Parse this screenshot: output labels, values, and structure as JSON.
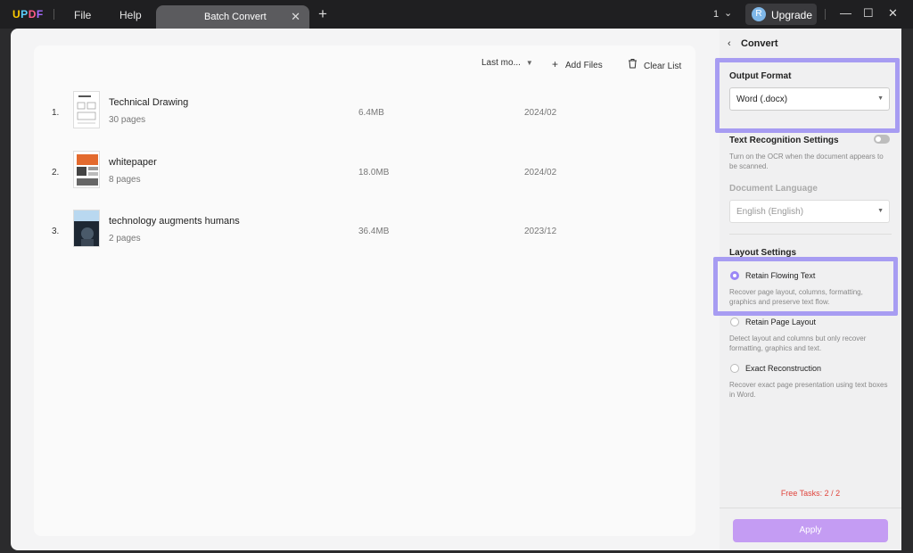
{
  "titlebar": {
    "logo": "UPDF",
    "menu_file": "File",
    "menu_help": "Help",
    "tab_label": "Batch Convert",
    "tab_close_icon": "close-icon",
    "tab_add_icon": "plus-icon",
    "page_indicator": "1",
    "upgrade_avatar": "R",
    "upgrade_label": "Upgrade"
  },
  "toolbar": {
    "sort_label": "Last mo...",
    "add_files_label": "Add Files",
    "clear_list_label": "Clear List"
  },
  "files": [
    {
      "index": "1.",
      "name": "Technical Drawing",
      "pages": "30 pages",
      "size": "6.4MB",
      "date": "2024/02"
    },
    {
      "index": "2.",
      "name": "whitepaper",
      "pages": "8 pages",
      "size": "18.0MB",
      "date": "2024/02"
    },
    {
      "index": "3.",
      "name": "technology augments humans",
      "pages": "2 pages",
      "size": "36.4MB",
      "date": "2023/12"
    }
  ],
  "panel": {
    "title": "Convert",
    "output_format_title": "Output Format",
    "output_format_value": "Word (.docx)",
    "ocr_title": "Text Recognition Settings",
    "ocr_desc": "Turn on the OCR when the document appears to be scanned.",
    "doc_lang_title": "Document Language",
    "doc_lang_value": "English (English)",
    "layout_title": "Layout Settings",
    "options": [
      {
        "label": "Retain Flowing Text",
        "desc": "Recover page layout, columns, formatting, graphics and preserve text flow."
      },
      {
        "label": "Retain Page Layout",
        "desc": "Detect layout and columns but only recover formatting, graphics and text."
      },
      {
        "label": "Exact Reconstruction",
        "desc": "Recover exact page presentation using text boxes in Word."
      }
    ],
    "free_tasks": "Free Tasks: 2 / 2",
    "apply_label": "Apply"
  },
  "colors": {
    "accent": "#9b87f5",
    "highlight": "#a79cf2",
    "apply_bg": "#c49cf3",
    "free_tasks": "#e0443c"
  }
}
